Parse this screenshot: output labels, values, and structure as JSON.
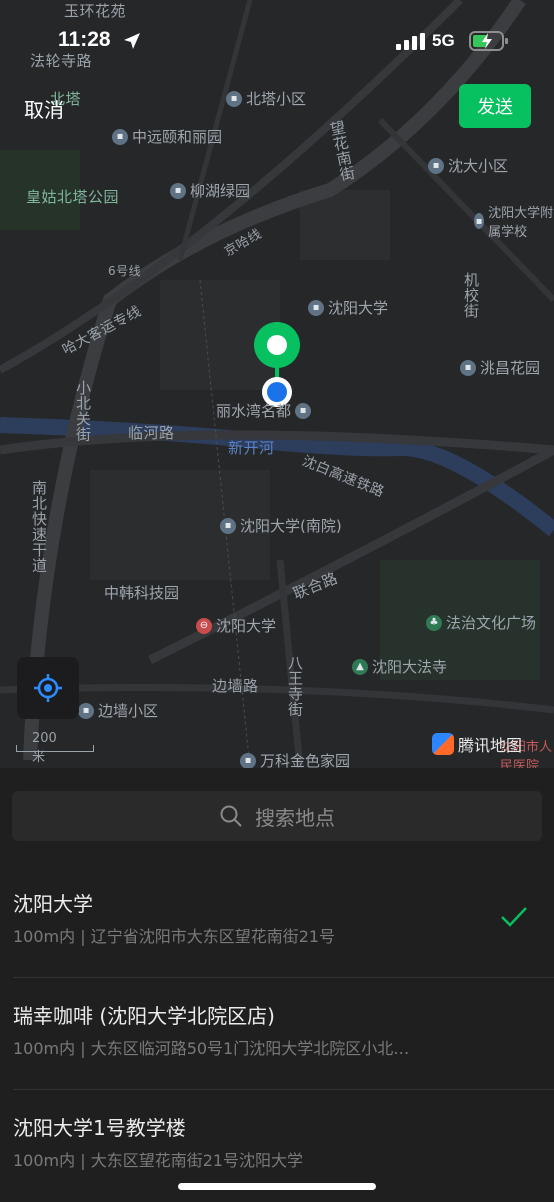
{
  "status_bar": {
    "time": "11:28",
    "network": "5G"
  },
  "header": {
    "cancel_label": "取消",
    "send_label": "发送"
  },
  "map": {
    "roads": [
      "法轮寺路",
      "京哈线",
      "6号线",
      "哈大客运专线",
      "小北关街",
      "临河路",
      "新开河",
      "沈白高速铁路",
      "南北快速干道",
      "联合路",
      "八王寺街",
      "边墙路",
      "望花南街",
      "机校街",
      "皇姑北塔公园",
      "北塔",
      "玉环花苑"
    ],
    "pois": [
      "北塔小区",
      "中远颐和丽园",
      "柳湖绿园",
      "沈大小区",
      "沈阳大学附属学校",
      "沈阳大学",
      "洮昌花园",
      "丽水湾名都",
      "沈阳大学(南院)",
      "中韩科技园",
      "沈阳大学",
      "法治文化广场",
      "沈阳大法寺",
      "边墙小区",
      "万科金色家园",
      "沈阳市人民医院"
    ],
    "scale_label": "200 米",
    "provider_label": "腾讯地图"
  },
  "search": {
    "placeholder": "搜索地点"
  },
  "results": [
    {
      "title": "沈阳大学",
      "subtitle": "100m内 | 辽宁省沈阳市大东区望花南街21号",
      "selected": true
    },
    {
      "title": "瑞幸咖啡 (沈阳大学北院区店)",
      "subtitle": "100m内 | 大东区临河路50号1门沈阳大学北院区小北…",
      "selected": false
    },
    {
      "title": "沈阳大学1号教学楼",
      "subtitle": "100m内 | 大东区望花南街21号沈阳大学",
      "selected": false
    }
  ],
  "colors": {
    "accent": "#07c160",
    "background": "#1f1f1f"
  }
}
